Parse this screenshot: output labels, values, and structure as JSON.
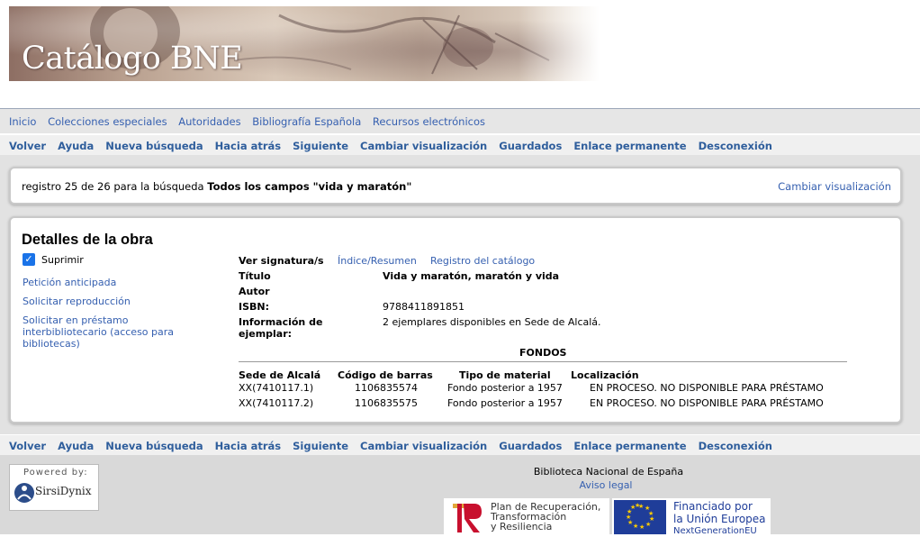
{
  "banner": {
    "title": "Catálogo BNE"
  },
  "top_nav": {
    "items": [
      "Inicio",
      "Colecciones especiales",
      "Autoridades",
      "Bibliografía Española",
      "Recursos electrónicos"
    ]
  },
  "command_bar": {
    "items": [
      "Volver",
      "Ayuda",
      "Nueva búsqueda",
      "Hacia atrás",
      "Siguiente",
      "Cambiar visualización",
      "Guardados",
      "Enlace permanente",
      "Desconexión"
    ]
  },
  "search_info": {
    "prefix": "registro 25 de 26 para la búsqueda",
    "query": "Todos los campos \"vida y maratón\"",
    "change_display": "Cambiar visualización"
  },
  "details": {
    "title": "Detalles de la obra",
    "suppress_label": "Suprimir",
    "suppress_checked": true,
    "side_links": [
      "Petición anticipada",
      "Solicitar reproducción",
      "Solicitar en préstamo interbibliotecario (acceso para bibliotecas)"
    ],
    "view_label": "Ver signatura/s",
    "view_links": [
      "Índice/Resumen",
      "Registro del catálogo"
    ],
    "fields": [
      {
        "label": "Título",
        "value": "Vida y maratón, maratón y vida",
        "bold": true
      },
      {
        "label": "Autor",
        "value": ""
      },
      {
        "label": "ISBN:",
        "value": "9788411891851"
      },
      {
        "label": "Información de ejemplar:",
        "value": "2 ejemplares disponibles en Sede de Alcalá."
      }
    ],
    "holdings": {
      "title": "FONDOS",
      "columns": [
        "Sede de Alcalá",
        "Código de barras",
        "Tipo de material",
        "Localización"
      ],
      "rows": [
        [
          "XX(7410117.1)",
          "1106835574",
          "Fondo posterior a 1957",
          "EN PROCESO. NO DISPONIBLE PARA PRÉSTAMO"
        ],
        [
          "XX(7410117.2)",
          "1106835575",
          "Fondo posterior a 1957",
          "EN PROCESO. NO DISPONIBLE PARA PRÉSTAMO"
        ]
      ]
    }
  },
  "footer": {
    "powered_by": "Powered by:",
    "powered_brand": "SirsiDynix",
    "organization": "Biblioteca Nacional de España",
    "legal_link": "Aviso legal",
    "prtr_text": [
      "Plan de Recuperación,",
      "Transformación",
      "y Resiliencia"
    ],
    "eu_text": [
      "Financiado por",
      "la Unión Europea"
    ],
    "eu_sub": "NextGenerationEU"
  },
  "colors": {
    "link": "#3660b0",
    "command": "#2f5e9c",
    "checkbox": "#1a73e8",
    "eu_blue": "#1f3d99"
  }
}
